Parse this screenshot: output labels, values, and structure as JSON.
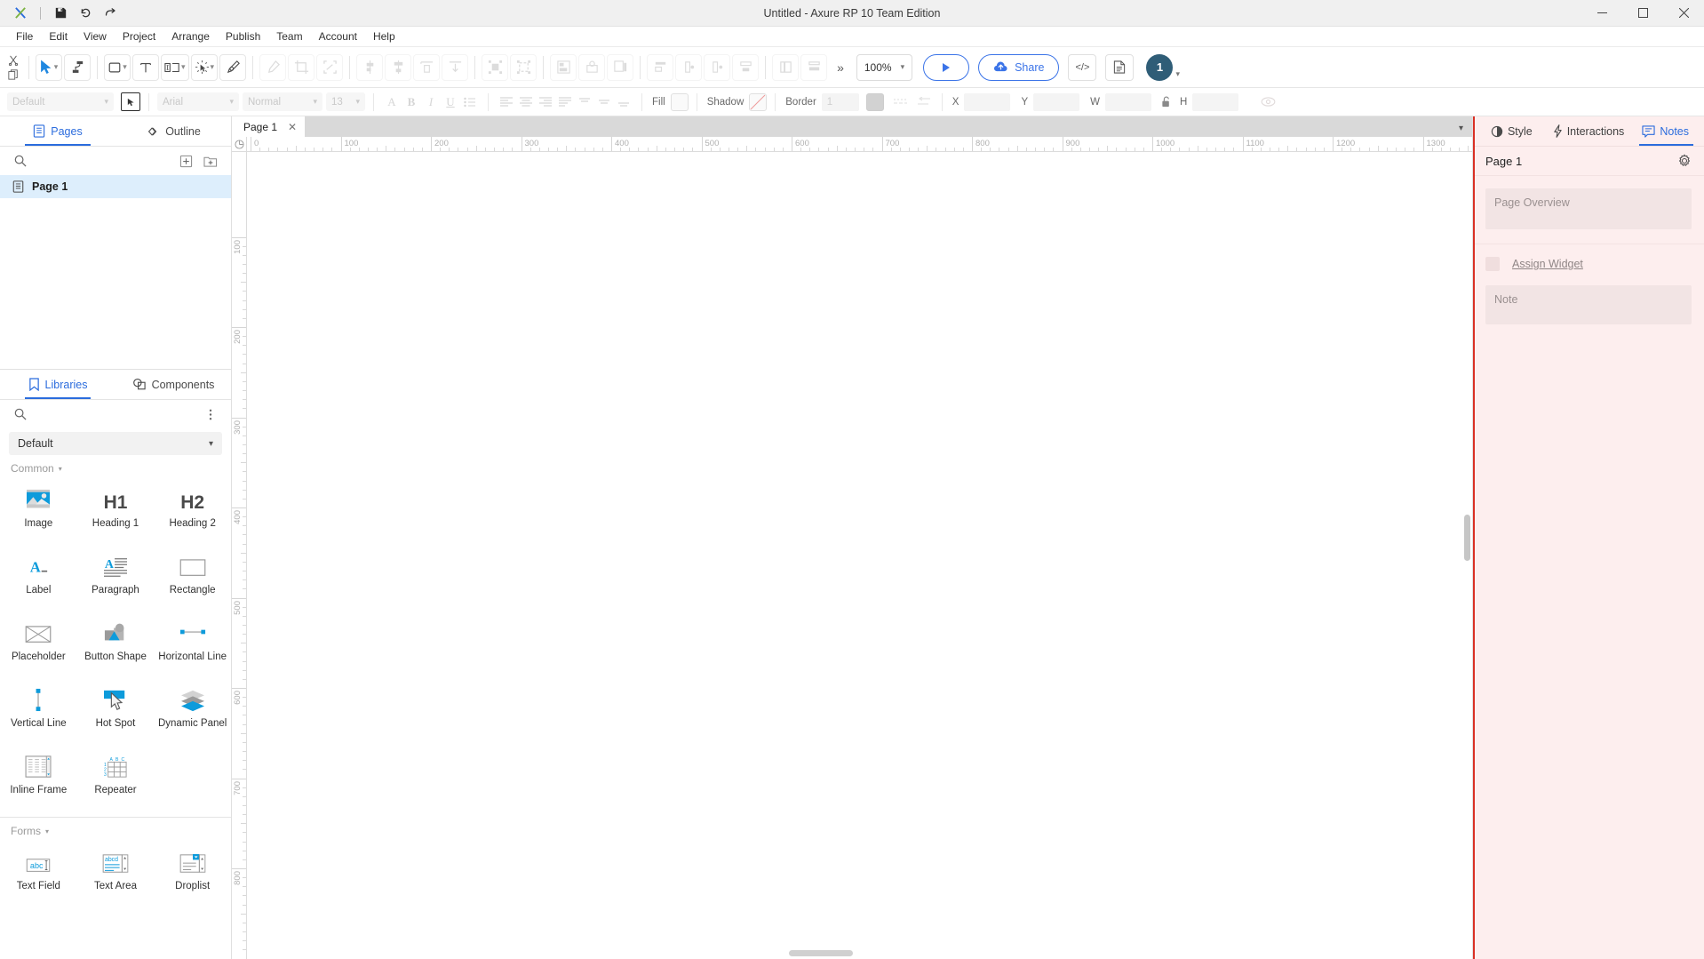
{
  "window": {
    "title": "Untitled - Axure RP 10 Team Edition",
    "controls": {
      "minimize": "minimize-icon",
      "maximize": "maximize-icon",
      "close": "close-icon"
    },
    "quick_actions": [
      "axure-logo-icon",
      "save-icon",
      "undo-icon",
      "redo-icon"
    ]
  },
  "menubar": {
    "items": [
      "File",
      "Edit",
      "View",
      "Project",
      "Arrange",
      "Publish",
      "Team",
      "Account",
      "Help"
    ]
  },
  "toolbar": {
    "clipboard": [
      "cut-icon",
      "copy-icon"
    ],
    "tools": [
      {
        "name": "select-tool",
        "icon": "cursor-icon",
        "caret": true
      },
      {
        "name": "connector-tool",
        "icon": "connector-icon",
        "caret": false
      }
    ],
    "shape_tools": [
      {
        "name": "rectangle-tool",
        "icon": "rectangle-icon",
        "caret": true
      },
      {
        "name": "text-tool",
        "icon": "text-icon",
        "caret": false
      },
      {
        "name": "box-tool",
        "icon": "box-layout-icon",
        "caret": true
      },
      {
        "name": "transform-tool",
        "icon": "transform-icon",
        "caret": true
      },
      {
        "name": "pen-tool",
        "icon": "pen-icon",
        "caret": false
      }
    ],
    "edit_tools": [
      "eyedropper-icon",
      "crop-icon",
      "fit-icon"
    ],
    "align_tools": [
      "align-left-icon",
      "align-center-icon",
      "align-right-icon",
      "align-top-icon",
      "align-middle-icon",
      "align-bottom-icon"
    ],
    "group_tools": [
      "group-icon",
      "ungroup-icon"
    ],
    "order_tools": [
      "bring-front-icon",
      "bring-forward-icon",
      "send-backward-icon"
    ],
    "distribute_tools": [
      "distribute-horizontal-icon",
      "distribute-vertical-icon",
      "flip-horizontal-icon",
      "flip-vertical-icon"
    ],
    "more_label": "»",
    "zoom": {
      "value": "100%",
      "caret": "chevron-down-icon"
    },
    "preview_label": "",
    "preview_icon": "play-icon",
    "share_label": "Share",
    "share_icon": "cloud-upload-icon",
    "code_label": "</>",
    "doc_icon": "document-icon",
    "avatar_initial": "1"
  },
  "stylebar": {
    "style_select": {
      "value": "Default",
      "caret": "chevron-down-icon"
    },
    "style_picker_icon": "style-picker-icon",
    "font_family": {
      "value": "Arial",
      "caret": "chevron-down-icon"
    },
    "font_weight": {
      "value": "Normal",
      "caret": "chevron-down-icon"
    },
    "font_size": {
      "value": "13",
      "caret": "chevron-down-icon"
    },
    "text_buttons": [
      "font-color-A",
      "bold-B",
      "italic-I",
      "underline-U",
      "list-icon"
    ],
    "align_buttons": [
      "align-left-icon",
      "align-center-icon",
      "align-right-icon",
      "align-justify-icon",
      "valign-top-icon",
      "valign-middle-icon",
      "valign-bottom-icon"
    ],
    "fill_label": "Fill",
    "shadow_label": "Shadow",
    "border_label": "Border",
    "border_width": "1",
    "border_style_icon": "border-style-icon",
    "border_arrow_icon": "arrow-style-icon",
    "x_label": "X",
    "x_value": "",
    "y_label": "Y",
    "y_value": "",
    "w_label": "W",
    "w_value": "",
    "h_label": "H",
    "h_value": "",
    "lock_icon": "lock-open-icon",
    "visibility_icon": "eye-icon"
  },
  "left_panel": {
    "tabs": [
      {
        "label": "Pages",
        "icon": "pages-icon",
        "active": true
      },
      {
        "label": "Outline",
        "icon": "outline-icon",
        "active": false
      }
    ],
    "search_icon": "search-icon",
    "add_page_icon": "add-page-icon",
    "add_folder_icon": "add-folder-icon",
    "pages": [
      {
        "label": "Page 1",
        "icon": "page-icon",
        "selected": true
      }
    ],
    "lib_tabs": [
      {
        "label": "Libraries",
        "icon": "library-icon",
        "active": true
      },
      {
        "label": "Components",
        "icon": "components-icon",
        "active": false
      }
    ],
    "lib_search_icon": "search-icon",
    "lib_more_icon": "more-vertical-icon",
    "lib_select": {
      "value": "Default",
      "caret": "chevron-down-icon"
    },
    "groups": [
      {
        "name": "Common",
        "caret": "caret-down-icon",
        "widgets": [
          {
            "label": "Image",
            "icon": "image-widget-icon"
          },
          {
            "label": "Heading 1",
            "icon": "h1-widget-icon"
          },
          {
            "label": "Heading 2",
            "icon": "h2-widget-icon"
          },
          {
            "label": "Label",
            "icon": "label-widget-icon"
          },
          {
            "label": "Paragraph",
            "icon": "paragraph-widget-icon"
          },
          {
            "label": "Rectangle",
            "icon": "rectangle-widget-icon"
          },
          {
            "label": "Placeholder",
            "icon": "placeholder-widget-icon"
          },
          {
            "label": "Button Shape",
            "icon": "button-shape-widget-icon"
          },
          {
            "label": "Horizontal Line",
            "icon": "horizontal-line-widget-icon"
          },
          {
            "label": "Vertical Line",
            "icon": "vertical-line-widget-icon"
          },
          {
            "label": "Hot Spot",
            "icon": "hot-spot-widget-icon"
          },
          {
            "label": "Dynamic Panel",
            "icon": "dynamic-panel-widget-icon"
          },
          {
            "label": "Inline Frame",
            "icon": "inline-frame-widget-icon"
          },
          {
            "label": "Repeater",
            "icon": "repeater-widget-icon"
          }
        ]
      },
      {
        "name": "Forms",
        "caret": "caret-down-icon",
        "widgets": [
          {
            "label": "Text Field",
            "icon": "text-field-widget-icon"
          },
          {
            "label": "Text Area",
            "icon": "text-area-widget-icon"
          },
          {
            "label": "Droplist",
            "icon": "droplist-widget-icon"
          }
        ]
      }
    ]
  },
  "canvas": {
    "tab": {
      "label": "Page 1",
      "close_icon": "close-icon"
    },
    "tab_caret": "chevron-down-icon",
    "h_ruler_labels": [
      "0",
      "100",
      "200",
      "300",
      "400",
      "500",
      "600",
      "700",
      "800",
      "900",
      "1000",
      "1100",
      "1200",
      "1300"
    ],
    "v_ruler_labels": [
      "100",
      "200",
      "300",
      "400",
      "500",
      "600",
      "700",
      "800"
    ],
    "corner_icon": "ruler-origin-icon"
  },
  "right_panel": {
    "tabs": [
      {
        "label": "Style",
        "icon": "style-icon",
        "active": false
      },
      {
        "label": "Interactions",
        "icon": "interactions-icon",
        "active": false
      },
      {
        "label": "Notes",
        "icon": "notes-icon",
        "active": true
      }
    ],
    "header_title": "Page 1",
    "gear_icon": "gear-icon",
    "page_overview_placeholder": "Page Overview",
    "assign_widget_label": "Assign Widget",
    "note_placeholder": "Note"
  },
  "colors": {
    "accent": "#2b6cdd",
    "share_blue": "#3b74e8",
    "selection_blue": "#ddeefc",
    "avatar": "#2f5d77",
    "highlight_red": "#d93025",
    "highlight_bg": "#fdeeee",
    "widget_blue": "#0d9bdb"
  }
}
